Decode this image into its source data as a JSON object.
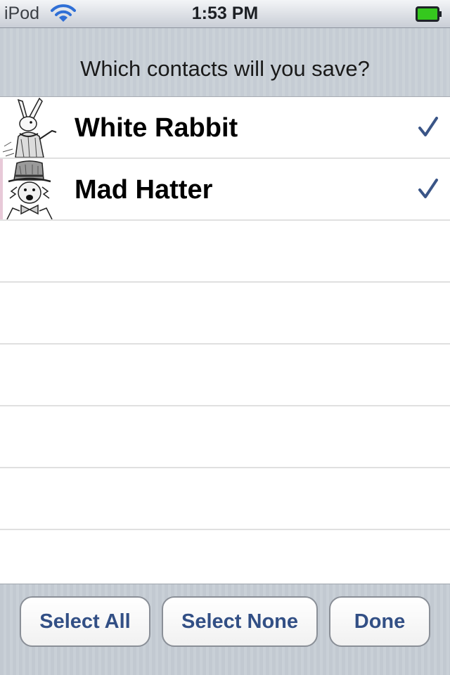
{
  "status_bar": {
    "carrier": "iPod",
    "time": "1:53 PM",
    "wifi_icon": "wifi-icon",
    "battery_icon": "battery-full-icon",
    "battery_color": "#35c81e"
  },
  "header": {
    "title": "Which contacts will you save?"
  },
  "contacts": [
    {
      "name": "White Rabbit",
      "thumbnail": "white-rabbit-illustration",
      "checked": true
    },
    {
      "name": "Mad Hatter",
      "thumbnail": "mad-hatter-illustration",
      "checked": true
    }
  ],
  "check_icon": "checkmark-icon",
  "check_color": "#3a5587",
  "toolbar": {
    "select_all_label": "Select All",
    "select_none_label": "Select None",
    "done_label": "Done"
  },
  "colors": {
    "button_text": "#324f85",
    "header_bg": "#c5ccd4",
    "row_separator": "#e0e0e0"
  }
}
